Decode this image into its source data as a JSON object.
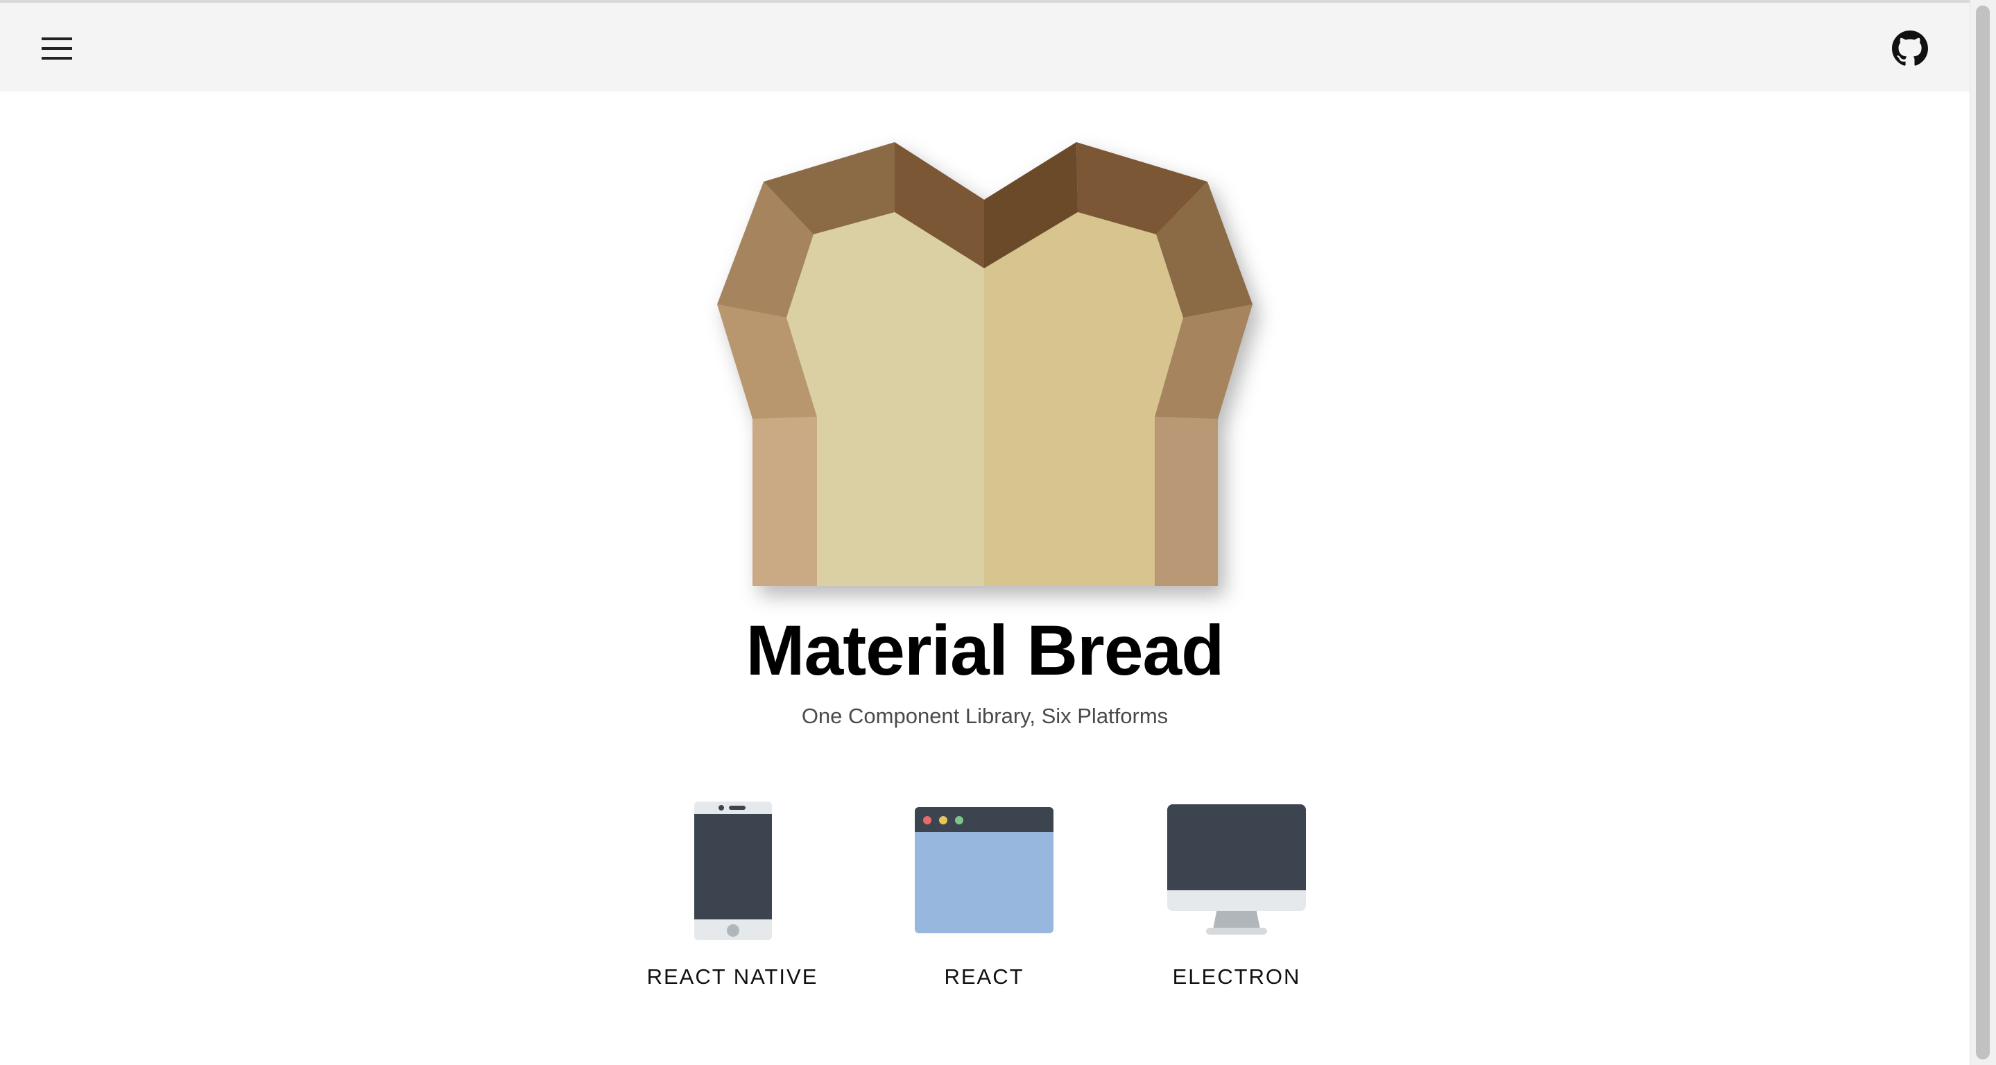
{
  "app": {
    "title": "Material Bread",
    "subtitle": "One Component Library, Six Platforms"
  },
  "header": {
    "menu_icon": "hamburger-menu-icon",
    "github_icon": "github-icon"
  },
  "platforms": [
    {
      "label": "REACT NATIVE",
      "icon": "phone-icon"
    },
    {
      "label": "REACT",
      "icon": "browser-window-icon"
    },
    {
      "label": "ELECTRON",
      "icon": "desktop-monitor-icon"
    }
  ],
  "colors": {
    "appbar_bg": "#f4f4f4",
    "title": "#000000",
    "subtitle": "#4a4a4a",
    "device_dark": "#3b444f",
    "browser_blue": "#98b7de",
    "bread_crust_dark": "#6b4a2a",
    "bread_crumb_light": "#dbd0a3",
    "bread_crumb": "#d7c48e"
  }
}
